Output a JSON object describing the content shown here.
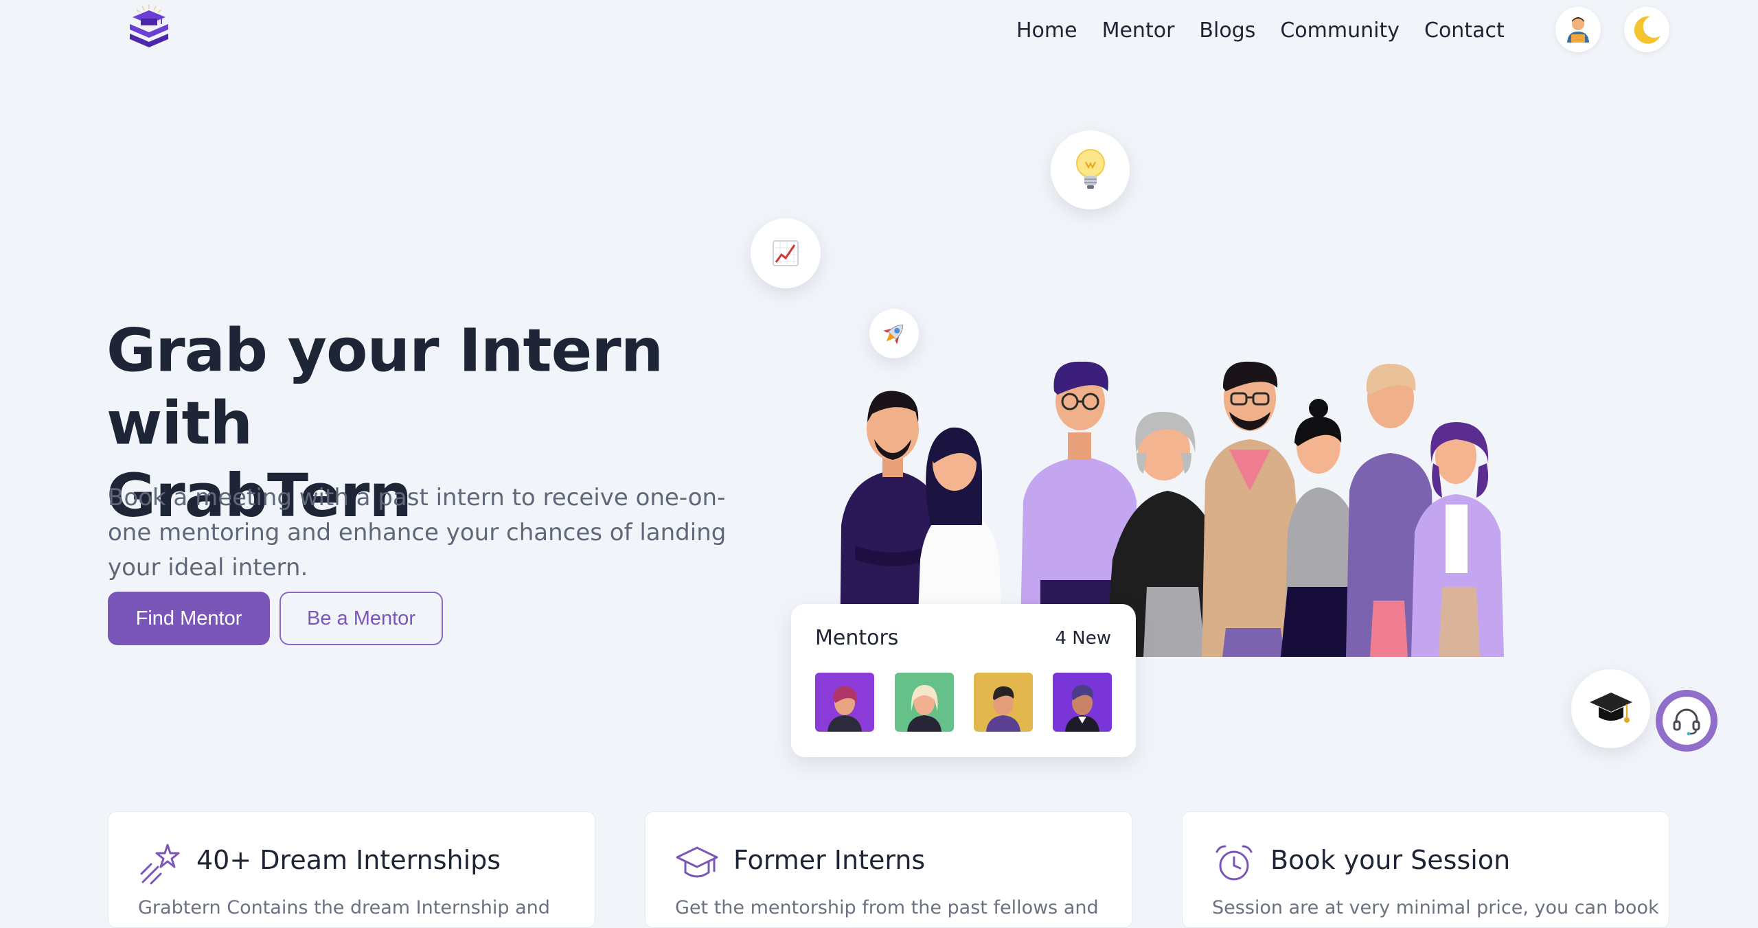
{
  "nav": {
    "links": [
      "Home",
      "Mentor",
      "Blogs",
      "Community",
      "Contact"
    ]
  },
  "hero": {
    "title_line1": "Grab your Intern with",
    "title_line2": "GrabTern",
    "subtitle": "Book a meeting with a past intern to receive one-on-one mentoring and enhance your chances of landing your ideal intern.",
    "primary_button": "Find Mentor",
    "secondary_button": "Be a Mentor"
  },
  "bubbles": {
    "bulb": "💡",
    "chart": "📈",
    "rocket": "🚀",
    "cap": "🎓"
  },
  "mentors_card": {
    "title": "Mentors",
    "count": "4 New",
    "avatars": [
      {
        "bg": "#8a3bd8",
        "hair": "#b0366a",
        "skin": "#e8a582",
        "shirt": "#2c2b3b"
      },
      {
        "bg": "#66c08a",
        "hair": "#f4e6c8",
        "skin": "#f1b08f",
        "shirt": "#262636"
      },
      {
        "bg": "#e2b84e",
        "hair": "#2a2326",
        "skin": "#e39e79",
        "shirt": "#5a3f93"
      },
      {
        "bg": "#7a35d8",
        "hair": "#4a3f86",
        "skin": "#c98467",
        "shirt": "#1d1a2a"
      }
    ]
  },
  "features": [
    {
      "title": "40+ Dream Internships",
      "desc": "Grabtern Contains the dream Internship and"
    },
    {
      "title": "Former Interns",
      "desc": "Get the mentorship from the past fellows and"
    },
    {
      "title": "Book your Session",
      "desc": "Session are at very minimal price, you can book"
    }
  ],
  "colors": {
    "accent": "#7b56b9",
    "background": "#f1f4f9"
  }
}
